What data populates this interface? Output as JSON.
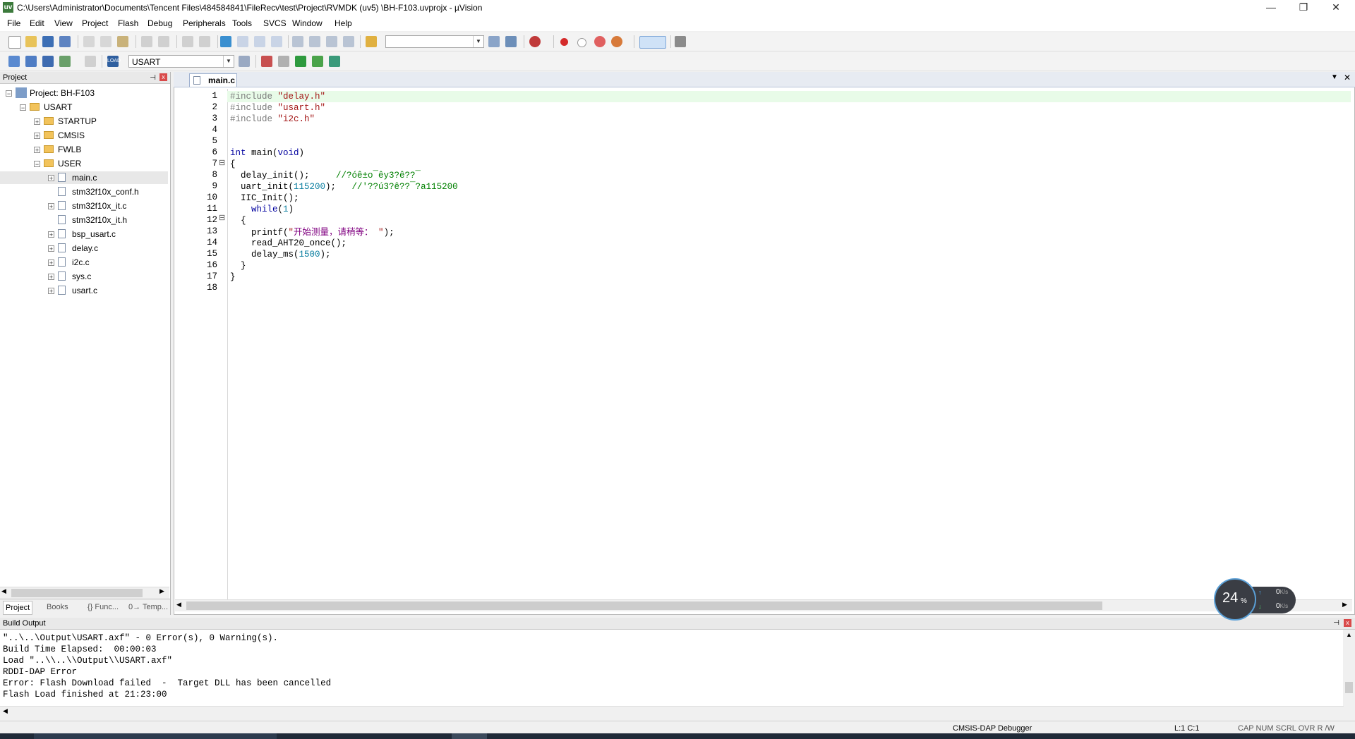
{
  "window": {
    "title": "C:\\Users\\Administrator\\Documents\\Tencent Files\\484584841\\FileRecv\\test\\Project\\RVMDK  (uv5)  \\BH-F103.uvprojx - µVision",
    "app_icon": "uv",
    "controls": {
      "minimize": "—",
      "maximize": "❐",
      "close": "✕"
    }
  },
  "menu": [
    "File",
    "Edit",
    "View",
    "Project",
    "Flash",
    "Debug",
    "Peripherals",
    "Tools",
    "SVCS",
    "Window",
    "Help"
  ],
  "toolbar2": {
    "target_select": "USART"
  },
  "project_pane": {
    "header": "Project",
    "pin": "⊣",
    "close": "x",
    "tree": [
      {
        "label": "Project: BH-F103",
        "level": 0,
        "type": "project",
        "expander": "−"
      },
      {
        "label": "USART",
        "level": 1,
        "type": "target",
        "expander": "−"
      },
      {
        "label": "STARTUP",
        "level": 2,
        "type": "folder",
        "expander": "+"
      },
      {
        "label": "CMSIS",
        "level": 2,
        "type": "folder",
        "expander": "+"
      },
      {
        "label": "FWLB",
        "level": 2,
        "type": "folder",
        "expander": "+"
      },
      {
        "label": "USER",
        "level": 2,
        "type": "folder",
        "expander": "−"
      },
      {
        "label": "main.c",
        "level": 3,
        "type": "file",
        "expander": "+"
      },
      {
        "label": "stm32f10x_conf.h",
        "level": 3,
        "type": "file",
        "expander": ""
      },
      {
        "label": "stm32f10x_it.c",
        "level": 3,
        "type": "file",
        "expander": "+"
      },
      {
        "label": "stm32f10x_it.h",
        "level": 3,
        "type": "file",
        "expander": ""
      },
      {
        "label": "bsp_usart.c",
        "level": 3,
        "type": "file",
        "expander": "+"
      },
      {
        "label": "delay.c",
        "level": 3,
        "type": "file",
        "expander": "+"
      },
      {
        "label": "i2c.c",
        "level": 3,
        "type": "file",
        "expander": "+"
      },
      {
        "label": "sys.c",
        "level": 3,
        "type": "file",
        "expander": "+"
      },
      {
        "label": "usart.c",
        "level": 3,
        "type": "file",
        "expander": "+"
      }
    ],
    "tabs": [
      "Project",
      "Books",
      "{} Func...",
      "0→ Temp..."
    ]
  },
  "editor": {
    "tab": "main.c",
    "line_numbers": [
      "1",
      "2",
      "3",
      "4",
      "5",
      "6",
      "7",
      "8",
      "9",
      "10",
      "11",
      "12",
      "13",
      "14",
      "15",
      "16",
      "17",
      "18"
    ],
    "code": {
      "l1_pp": "#include ",
      "l1_str": "\"delay.h\"",
      "l2_pp": "#include ",
      "l2_str": "\"usart.h\"",
      "l3_pp": "#include ",
      "l3_str": "\"i2c.h\"",
      "l6_kw1": "int",
      "l6_fn": " main(",
      "l6_kw2": "void",
      "l6_end": ")",
      "l7": "{",
      "l8_code": "  delay_init();     ",
      "l8_cmt": "//?óê±o¯êy3?ê??¯",
      "l9_code": "  uart_init(",
      "l9_num": "115200",
      "l9_end": ");   ",
      "l9_cmt": "//'??ú3?ê??¯?a115200",
      "l10": "  IIC_Init();",
      "l11_pre": "    ",
      "l11_kw": "while",
      "l11_open": "(",
      "l11_num": "1",
      "l11_close": ")",
      "l12": "  {",
      "l13_pre": "    printf(",
      "l13_q1": "\"",
      "l13_cjk": "开始测量，请稍等：",
      "l13_q2": " \"",
      "l13_end": ");",
      "l14": "    read_AHT20_once();",
      "l15_pre": "    delay_ms(",
      "l15_num": "1500",
      "l15_end": ");",
      "l16": "  }",
      "l17": "}"
    },
    "fold_markers": {
      "l7": "⊟",
      "l12": "⊟"
    }
  },
  "build_output": {
    "header": "Build Output",
    "lines": [
      "\"..\\..\\Output\\USART.axf\" - 0 Error(s), 0 Warning(s).",
      "Build Time Elapsed:  00:00:03",
      "Load \"..\\\\..\\\\Output\\\\USART.axf\"",
      "RDDI-DAP Error",
      "Error: Flash Download failed  -  Target DLL has been cancelled",
      "Flash Load finished at 21:23:00"
    ]
  },
  "status_bar": {
    "debugger": "CMSIS-DAP Debugger",
    "cursor": "L:1 C:1",
    "indicators": "CAP  NUM  SCRL  OVR  R /W"
  },
  "speed_widget": {
    "percent": "24",
    "percent_unit": "%",
    "up": "0",
    "down": "0",
    "unit": "K/s"
  },
  "colors": {
    "accent": "#3c7a3c",
    "current_line": "#e8fbe8",
    "comment": "#008000",
    "keyword": "#00009f",
    "string": "#a31515"
  }
}
